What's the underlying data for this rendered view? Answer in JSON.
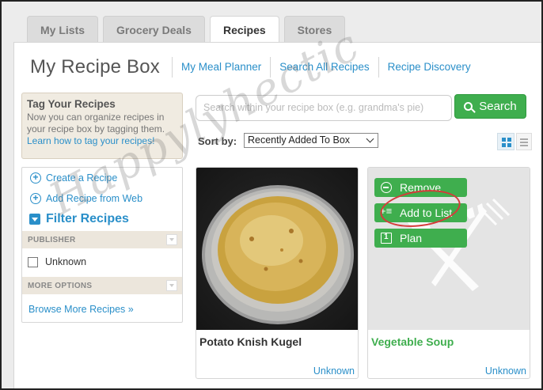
{
  "tabs": [
    {
      "label": "My Lists"
    },
    {
      "label": "Grocery Deals"
    },
    {
      "label": "Recipes"
    },
    {
      "label": "Stores"
    }
  ],
  "header": {
    "title": "My Recipe Box",
    "links": [
      {
        "label": "My Meal Planner"
      },
      {
        "label": "Search All Recipes"
      },
      {
        "label": "Recipe Discovery"
      }
    ]
  },
  "tag_box": {
    "title": "Tag Your Recipes",
    "text": "Now you can organize recipes in your recipe box by tagging them.",
    "link": "Learn how to tag your recipes!"
  },
  "sidebar": {
    "create": "Create a Recipe",
    "add_from_web": "Add Recipe from Web",
    "filter_title": "Filter Recipes",
    "publisher_label": "PUBLISHER",
    "publisher_option": "Unknown",
    "more_options_label": "MORE OPTIONS",
    "browse_more": "Browse More Recipes »"
  },
  "search": {
    "placeholder": "Search within your recipe box (e.g. grandma's pie)",
    "button": "Search"
  },
  "sort": {
    "label": "Sort by:",
    "selected": "Recently Added To Box"
  },
  "cards": [
    {
      "name": "Potato Knish Kugel",
      "source": "Unknown"
    },
    {
      "name": "Vegetable Soup",
      "source": "Unknown"
    }
  ],
  "overlay": {
    "remove": "Remove",
    "add_to_list": "Add to List",
    "plan": "Plan"
  },
  "watermark": "Happylyhectic",
  "colors": {
    "accent_blue": "#2a8fc9",
    "green": "#3fae4e",
    "annotation_red": "#d63a3a"
  }
}
